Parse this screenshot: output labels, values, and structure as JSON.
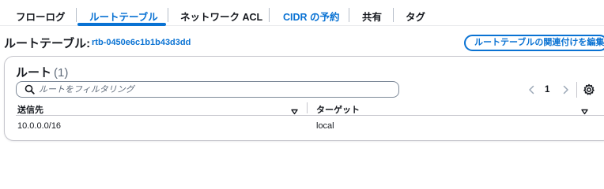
{
  "tabs": [
    {
      "label": "フローログ"
    },
    {
      "label": "ルートテーブル"
    },
    {
      "label": "ネットワーク ACL"
    },
    {
      "label": "CIDR の予約"
    },
    {
      "label": "共有"
    },
    {
      "label": "タグ"
    }
  ],
  "active_tab_index": 1,
  "header": {
    "title": "ルートテーブル:",
    "route_table_id": "rtb-0450e6c1b1b43d3dd",
    "edit_button_label": "ルートテーブルの関連付けを編集"
  },
  "routes": {
    "title": "ルート",
    "count": "(1)",
    "search_placeholder": "ルートをフィルタリング",
    "current_page": "1",
    "columns": [
      "送信先",
      "ターゲット"
    ],
    "rows": [
      {
        "destination": "10.0.0.0/16",
        "target": "local"
      }
    ]
  },
  "icons": [
    "search-icon",
    "chevron-left-icon",
    "chevron-right-icon",
    "gear-icon",
    "sort-down-icon"
  ],
  "colors": {
    "accent": "#0972d3",
    "text": "#16191f",
    "muted": "#5f6b7a",
    "border": "#c6c6cd"
  }
}
